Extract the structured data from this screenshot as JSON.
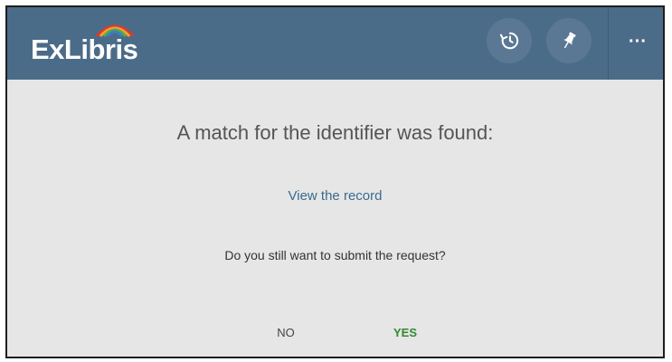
{
  "header": {
    "logo_text": "ExLibris",
    "icons": {
      "history": "history-icon",
      "pin": "pin-icon",
      "more": "more-options-icon"
    },
    "more_label": "···"
  },
  "dialog": {
    "message": "A match for the identifier was found:",
    "view_link": "View the record",
    "question": "Do you still want to submit the request?",
    "no_label": "NO",
    "yes_label": "YES"
  },
  "colors": {
    "header_bg": "#4b6c88",
    "content_bg": "#e6e6e6",
    "link": "#3a6b8f",
    "yes": "#2f8a2f"
  }
}
